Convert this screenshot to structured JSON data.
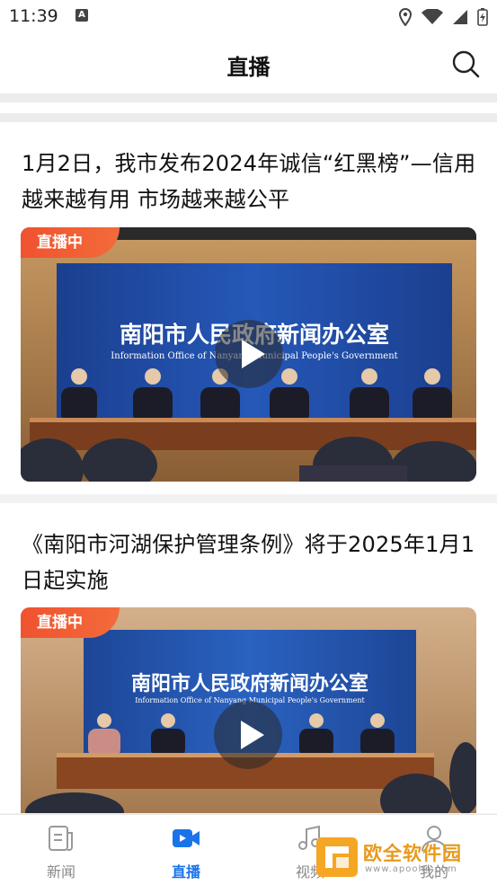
{
  "status_bar": {
    "time": "11:39",
    "a_icon": "A"
  },
  "header": {
    "title": "直播"
  },
  "cards": [
    {
      "title": "1月2日，我市发布2024年诚信“红黑榜”—信用越来越有用 市场越来越公平",
      "badge": "直播中",
      "banner_cn": "南阳市人民政府新闻办公室",
      "banner_en": "Information Office of Nanyang Municipal People's Government"
    },
    {
      "title": "《南阳市河湖保护管理条例》将于2025年1月1日起实施",
      "badge": "直播中",
      "banner_cn": "南阳市人民政府新闻办公室",
      "banner_en": "Information Office of Nanyang Municipal People's Government"
    }
  ],
  "nav": {
    "items": [
      {
        "label": "新闻",
        "icon": "news-icon",
        "active": false
      },
      {
        "label": "直播",
        "icon": "video-camera-icon",
        "active": true
      },
      {
        "label": "视频",
        "icon": "music-note-icon",
        "active": false
      },
      {
        "label": "我的",
        "icon": "person-icon",
        "active": false
      }
    ]
  },
  "watermark": {
    "text": "欧全软件园",
    "sub": "www.apoohn.com"
  },
  "colors": {
    "accent": "#1a73e8",
    "live_badge": "#f0522f",
    "banner_blue": "#1f4fa8"
  }
}
